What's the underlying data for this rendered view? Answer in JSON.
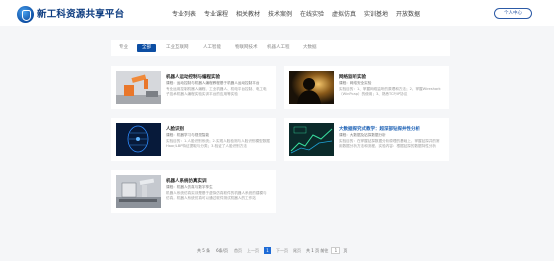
{
  "header": {
    "logo_text": "新工科资源共享平台",
    "nav": [
      "专业列表",
      "专业课程",
      "相关教材",
      "技术案例",
      "在线实验",
      "虚拟仿真",
      "实训基地",
      "开放数据"
    ],
    "user_center": "个人中心"
  },
  "filters": [
    "专业",
    "全部",
    "工业互联网",
    "人工智能",
    "物联网技术",
    "机器人工程",
    "大数据"
  ],
  "active_filter_index": 1,
  "cards": [
    {
      "title": "机器人运动控制与编程实验",
      "meta": "课程：运动控制与机器人编程教程基于机器人运动控制平台",
      "desc": "专业运用控制机器人编程、工业机器人、机电平台控制、电工电子技术机器人编程实验实训平台的应用等实验"
    },
    {
      "title": "网络监听实验",
      "meta": "课程：网络安全实验",
      "desc": "实验目的：1、掌握网络监听的原理和方法；2、掌握Wireshark（WinPcap）的使用；3、熟悉TCP/IP协议"
    },
    {
      "title": "人脸识别",
      "meta": "课程：机器学习与视觉智能",
      "desc": "实验目的：1.人脸识别系统；2.实现人脸检测与人脸识别模型数据Haar/LBP特征提取与分类；3.验证了人脸识别方法"
    },
    {
      "title": "大数据探究式教学：超深部钻探井性分析",
      "meta": "课程：大数据及钻探数据分析",
      "desc": "实验目的：在掌握钻探数据分析原理的基础上，掌握钻探井的常用数据分析方法和流程，实验内容：根据钻探的数据特性分析"
    },
    {
      "title": "机器人系统仿真实训",
      "meta": "课程：机器人仿真与数字孪生",
      "desc": "机器人系统仿真实训是基于虚拟仿真软件的机器人系统的建模与仿真，机器人系统仿真可以通过软件测试机器人的工作站"
    }
  ],
  "pagination": {
    "total": "共 5 条",
    "per_page": "6条/页",
    "first": "首页",
    "prev": "上一页",
    "current": "1",
    "next": "下一页",
    "last": "尾页",
    "summary": "共 1 页 前往",
    "goto_value": "1",
    "page_unit": "页"
  }
}
